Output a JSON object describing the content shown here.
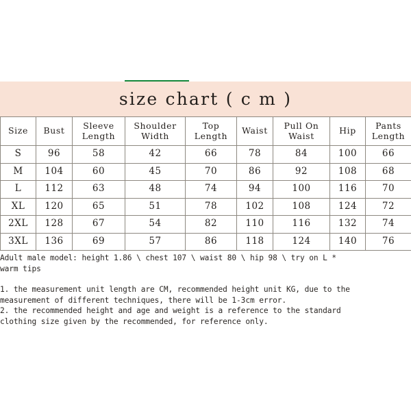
{
  "colors": {
    "accent_green": "#13883b",
    "title_band_background": "#f9e2d6",
    "page_background": "#ffffff",
    "table_border": "#8d8880",
    "text": "#231f1c"
  },
  "header": {
    "title": "size chart ( c m )"
  },
  "chart_data": {
    "type": "table",
    "title": "size chart ( c m )",
    "columns": [
      "Size",
      "Bust",
      "Sleeve\nLength",
      "Shoulder\nWidth",
      "Top\nLength",
      "Waist",
      "Pull On\nWaist",
      "Hip",
      "Pants\nLength"
    ],
    "rows": [
      [
        "S",
        "96",
        "58",
        "42",
        "66",
        "78",
        "84",
        "100",
        "66"
      ],
      [
        "M",
        "104",
        "60",
        "45",
        "70",
        "86",
        "92",
        "108",
        "68"
      ],
      [
        "L",
        "112",
        "63",
        "48",
        "74",
        "94",
        "100",
        "116",
        "70"
      ],
      [
        "XL",
        "120",
        "65",
        "51",
        "78",
        "102",
        "108",
        "124",
        "72"
      ],
      [
        "2XL",
        "128",
        "67",
        "54",
        "82",
        "110",
        "116",
        "132",
        "74"
      ],
      [
        "3XL",
        "136",
        "69",
        "57",
        "86",
        "118",
        "124",
        "140",
        "76"
      ]
    ],
    "unit": "cm"
  },
  "notes": {
    "model_info": "Adult male model: height 1.86 \\ chest 107 \\ waist 80 \\ hip 98 \\ try on L *\nwarm tips",
    "note_1": "1. the measurement unit length are CM, recommended height unit KG, due to the\nmeasurement of different techniques, there will be 1-3cm error.",
    "note_2": "2. the recommended height and age and weight is a reference to the standard\nclothing size given by the recommended, for reference only."
  }
}
